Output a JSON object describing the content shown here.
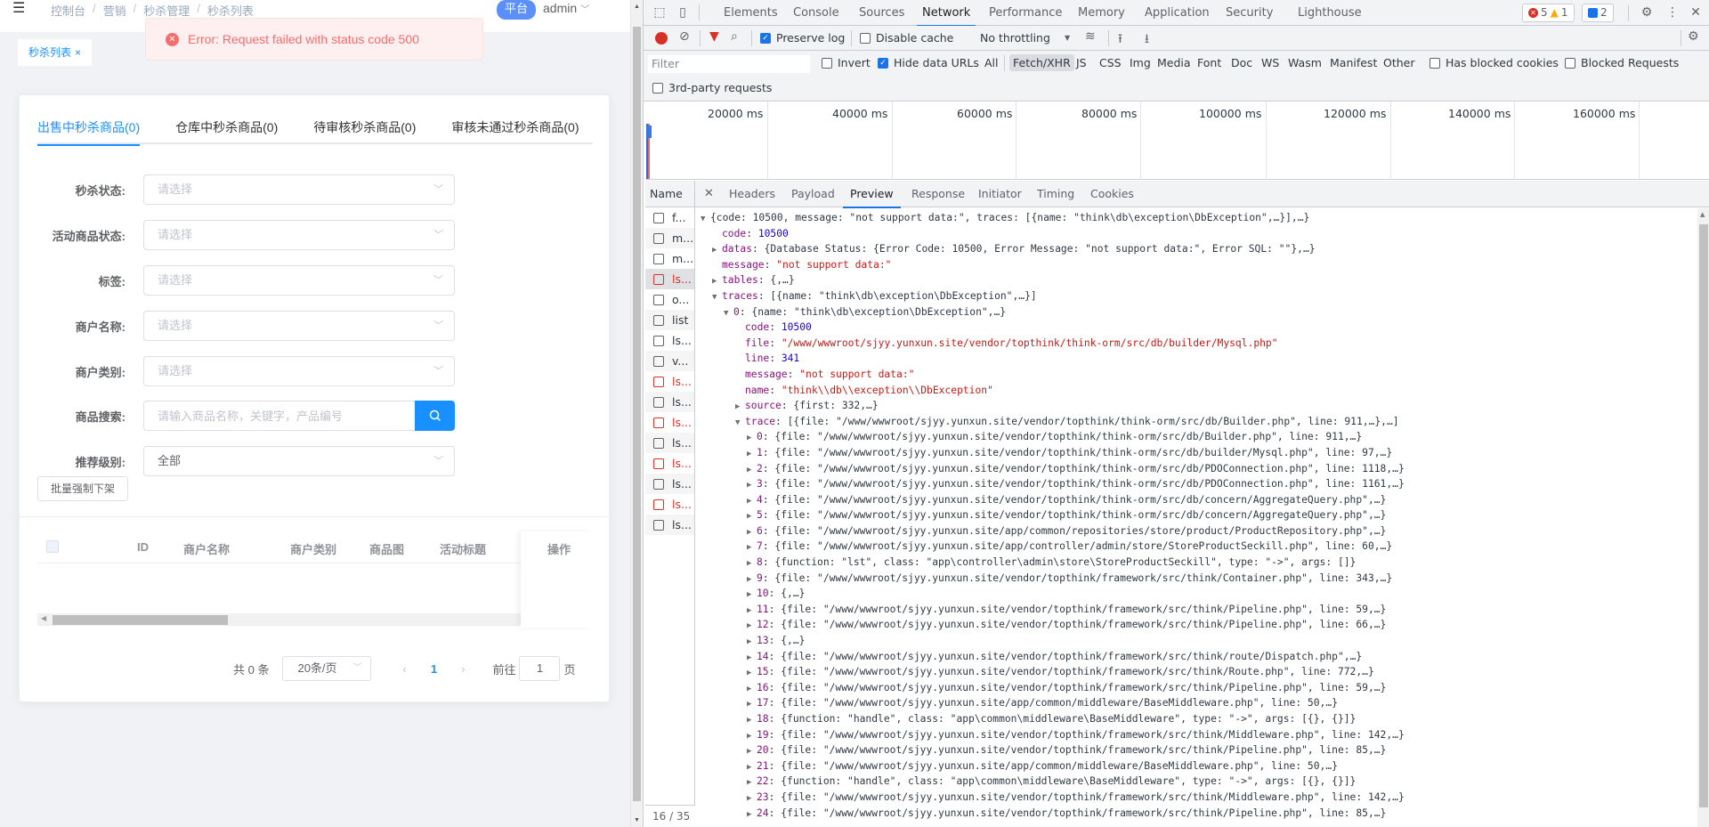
{
  "app": {
    "breadcrumb": [
      "控制台",
      "营销",
      "秒杀管理",
      "秒杀列表"
    ],
    "role_badge": "平台",
    "user": "admin",
    "tag": "秒杀列表",
    "error_message": "Error: Request failed with status code 500",
    "tabs": [
      {
        "label": "出售中秒杀商品(0)",
        "active": true
      },
      {
        "label": "仓库中秒杀商品(0)",
        "active": false
      },
      {
        "label": "待审核秒杀商品(0)",
        "active": false
      },
      {
        "label": "审核未通过秒杀商品(0)",
        "active": false
      }
    ],
    "filters": [
      {
        "label": "秒杀状态:",
        "placeholder": "请选择",
        "value": ""
      },
      {
        "label": "活动商品状态:",
        "placeholder": "请选择",
        "value": ""
      },
      {
        "label": "标签:",
        "placeholder": "请选择",
        "value": ""
      },
      {
        "label": "商户名称:",
        "placeholder": "请选择",
        "value": ""
      },
      {
        "label": "商户类别:",
        "placeholder": "请选择",
        "value": ""
      }
    ],
    "search": {
      "label": "商品搜索:",
      "placeholder": "请输入商品名称，关键字，产品编号"
    },
    "recommend": {
      "label": "推荐级别:",
      "value": "全部"
    },
    "batch_button": "批量强制下架",
    "table": {
      "columns": [
        "ID",
        "商户名称",
        "商户类别",
        "商品图",
        "活动标题"
      ],
      "fixed_column": "操作",
      "rows": []
    },
    "pagination": {
      "total": "共 0 条",
      "page_size": "20条/页",
      "current_page": "1",
      "goto_label": "前往",
      "goto_value": "1",
      "page_suffix": "页"
    }
  },
  "devtools": {
    "tabs": [
      "Elements",
      "Console",
      "Sources",
      "Network",
      "Performance",
      "Memory",
      "Application",
      "Security",
      "Lighthouse"
    ],
    "active_tab": "Network",
    "issues": {
      "errors": "5",
      "warnings": "1",
      "messages": "2"
    },
    "toolbar": {
      "preserve_log": "Preserve log",
      "preserve_log_checked": true,
      "disable_cache": "Disable cache",
      "disable_cache_checked": false,
      "throttling": "No throttling"
    },
    "filter": {
      "placeholder": "Filter",
      "invert": "Invert",
      "hide_data_urls": "Hide data URLs",
      "types": [
        "All",
        "Fetch/XHR",
        "JS",
        "CSS",
        "Img",
        "Media",
        "Font",
        "Doc",
        "WS",
        "Wasm",
        "Manifest",
        "Other"
      ],
      "selected_type": "Fetch/XHR",
      "has_blocked_cookies": "Has blocked cookies",
      "blocked_requests": "Blocked Requests",
      "third_party": "3rd-party requests"
    },
    "timeline_ticks": [
      "20000 ms",
      "40000 ms",
      "60000 ms",
      "80000 ms",
      "100000 ms",
      "120000 ms",
      "140000 ms",
      "160000 ms"
    ],
    "requests_header": "Name",
    "requests": [
      {
        "name": "f...",
        "error": false
      },
      {
        "name": "m...",
        "error": false
      },
      {
        "name": "m...",
        "error": false
      },
      {
        "name": "ls...",
        "error": true,
        "selected": true
      },
      {
        "name": "o...",
        "error": false
      },
      {
        "name": "list",
        "error": false
      },
      {
        "name": "ls...",
        "error": false
      },
      {
        "name": "v...",
        "error": false
      },
      {
        "name": "ls...",
        "error": true
      },
      {
        "name": "ls...",
        "error": false
      },
      {
        "name": "ls...",
        "error": true
      },
      {
        "name": "ls...",
        "error": false
      },
      {
        "name": "ls...",
        "error": true
      },
      {
        "name": "ls...",
        "error": false
      },
      {
        "name": "ls...",
        "error": true
      },
      {
        "name": "ls...",
        "error": false
      }
    ],
    "request_count": "16 / 35",
    "detail_tabs": [
      "Headers",
      "Payload",
      "Preview",
      "Response",
      "Initiator",
      "Timing",
      "Cookies"
    ],
    "active_detail_tab": "Preview",
    "preview_lines": [
      {
        "indent": 0,
        "tri": "down",
        "text": "{code: 10500, message: \"not support data:\", traces: [{name: \"think\\db\\exception\\DbException\",…}],…}",
        "kind": "summary"
      },
      {
        "indent": 1,
        "tri": "",
        "key": "code",
        "val": "10500",
        "vkind": "n"
      },
      {
        "indent": 1,
        "tri": "right",
        "key": "datas",
        "val": "{Database Status: {Error Code: 10500, Error Message: \"not support data:\", Error SQL: \"\"},…}",
        "vkind": "p"
      },
      {
        "indent": 1,
        "tri": "",
        "key": "message",
        "val": "\"not support data:\"",
        "vkind": "s"
      },
      {
        "indent": 1,
        "tri": "right",
        "key": "tables",
        "val": "{,…}",
        "vkind": "p"
      },
      {
        "indent": 1,
        "tri": "down",
        "key": "traces",
        "val": "[{name: \"think\\db\\exception\\DbException\",…}]",
        "vkind": "p"
      },
      {
        "indent": 2,
        "tri": "down",
        "key": "0",
        "val": "{name: \"think\\db\\exception\\DbException\",…}",
        "vkind": "p"
      },
      {
        "indent": 3,
        "tri": "",
        "key": "code",
        "val": "10500",
        "vkind": "n"
      },
      {
        "indent": 3,
        "tri": "",
        "key": "file",
        "val": "\"/www/wwwroot/sjyy.yunxun.site/vendor/topthink/think-orm/src/db/builder/Mysql.php\"",
        "vkind": "s"
      },
      {
        "indent": 3,
        "tri": "",
        "key": "line",
        "val": "341",
        "vkind": "n"
      },
      {
        "indent": 3,
        "tri": "",
        "key": "message",
        "val": "\"not support data:\"",
        "vkind": "s"
      },
      {
        "indent": 3,
        "tri": "",
        "key": "name",
        "val": "\"think\\\\db\\\\exception\\\\DbException\"",
        "vkind": "s"
      },
      {
        "indent": 3,
        "tri": "right",
        "key": "source",
        "val": "{first: 332,…}",
        "vkind": "p"
      },
      {
        "indent": 3,
        "tri": "down",
        "key": "trace",
        "val": "[{file: \"/www/wwwroot/sjyy.yunxun.site/vendor/topthink/think-orm/src/db/Builder.php\", line: 911,…},…]",
        "vkind": "p"
      },
      {
        "indent": 4,
        "tri": "right",
        "key": "0",
        "val": "{file: \"/www/wwwroot/sjyy.yunxun.site/vendor/topthink/think-orm/src/db/Builder.php\", line: 911,…}",
        "vkind": "p"
      },
      {
        "indent": 4,
        "tri": "right",
        "key": "1",
        "val": "{file: \"/www/wwwroot/sjyy.yunxun.site/vendor/topthink/think-orm/src/db/builder/Mysql.php\", line: 97,…}",
        "vkind": "p"
      },
      {
        "indent": 4,
        "tri": "right",
        "key": "2",
        "val": "{file: \"/www/wwwroot/sjyy.yunxun.site/vendor/topthink/think-orm/src/db/PDOConnection.php\", line: 1118,…}",
        "vkind": "p"
      },
      {
        "indent": 4,
        "tri": "right",
        "key": "3",
        "val": "{file: \"/www/wwwroot/sjyy.yunxun.site/vendor/topthink/think-orm/src/db/PDOConnection.php\", line: 1161,…}",
        "vkind": "p"
      },
      {
        "indent": 4,
        "tri": "right",
        "key": "4",
        "val": "{file: \"/www/wwwroot/sjyy.yunxun.site/vendor/topthink/think-orm/src/db/concern/AggregateQuery.php\",…}",
        "vkind": "p"
      },
      {
        "indent": 4,
        "tri": "right",
        "key": "5",
        "val": "{file: \"/www/wwwroot/sjyy.yunxun.site/vendor/topthink/think-orm/src/db/concern/AggregateQuery.php\",…}",
        "vkind": "p"
      },
      {
        "indent": 4,
        "tri": "right",
        "key": "6",
        "val": "{file: \"/www/wwwroot/sjyy.yunxun.site/app/common/repositories/store/product/ProductRepository.php\",…}",
        "vkind": "p"
      },
      {
        "indent": 4,
        "tri": "right",
        "key": "7",
        "val": "{file: \"/www/wwwroot/sjyy.yunxun.site/app/controller/admin/store/StoreProductSeckill.php\", line: 60,…}",
        "vkind": "p"
      },
      {
        "indent": 4,
        "tri": "right",
        "key": "8",
        "val": "{function: \"lst\", class: \"app\\controller\\admin\\store\\StoreProductSeckill\", type: \"->\", args: []}",
        "vkind": "p"
      },
      {
        "indent": 4,
        "tri": "right",
        "key": "9",
        "val": "{file: \"/www/wwwroot/sjyy.yunxun.site/vendor/topthink/framework/src/think/Container.php\", line: 343,…}",
        "vkind": "p"
      },
      {
        "indent": 4,
        "tri": "right",
        "key": "10",
        "val": "{,…}",
        "vkind": "p"
      },
      {
        "indent": 4,
        "tri": "right",
        "key": "11",
        "val": "{file: \"/www/wwwroot/sjyy.yunxun.site/vendor/topthink/framework/src/think/Pipeline.php\", line: 59,…}",
        "vkind": "p"
      },
      {
        "indent": 4,
        "tri": "right",
        "key": "12",
        "val": "{file: \"/www/wwwroot/sjyy.yunxun.site/vendor/topthink/framework/src/think/Pipeline.php\", line: 66,…}",
        "vkind": "p"
      },
      {
        "indent": 4,
        "tri": "right",
        "key": "13",
        "val": "{,…}",
        "vkind": "p"
      },
      {
        "indent": 4,
        "tri": "right",
        "key": "14",
        "val": "{file: \"/www/wwwroot/sjyy.yunxun.site/vendor/topthink/framework/src/think/route/Dispatch.php\",…}",
        "vkind": "p"
      },
      {
        "indent": 4,
        "tri": "right",
        "key": "15",
        "val": "{file: \"/www/wwwroot/sjyy.yunxun.site/vendor/topthink/framework/src/think/Route.php\", line: 772,…}",
        "vkind": "p"
      },
      {
        "indent": 4,
        "tri": "right",
        "key": "16",
        "val": "{file: \"/www/wwwroot/sjyy.yunxun.site/vendor/topthink/framework/src/think/Pipeline.php\", line: 59,…}",
        "vkind": "p"
      },
      {
        "indent": 4,
        "tri": "right",
        "key": "17",
        "val": "{file: \"/www/wwwroot/sjyy.yunxun.site/app/common/middleware/BaseMiddleware.php\", line: 50,…}",
        "vkind": "p"
      },
      {
        "indent": 4,
        "tri": "right",
        "key": "18",
        "val": "{function: \"handle\", class: \"app\\common\\middleware\\BaseMiddleware\", type: \"->\", args: [{}, {}]}",
        "vkind": "p"
      },
      {
        "indent": 4,
        "tri": "right",
        "key": "19",
        "val": "{file: \"/www/wwwroot/sjyy.yunxun.site/vendor/topthink/framework/src/think/Middleware.php\", line: 142,…}",
        "vkind": "p"
      },
      {
        "indent": 4,
        "tri": "right",
        "key": "20",
        "val": "{file: \"/www/wwwroot/sjyy.yunxun.site/vendor/topthink/framework/src/think/Pipeline.php\", line: 85,…}",
        "vkind": "p"
      },
      {
        "indent": 4,
        "tri": "right",
        "key": "21",
        "val": "{file: \"/www/wwwroot/sjyy.yunxun.site/app/common/middleware/BaseMiddleware.php\", line: 50,…}",
        "vkind": "p"
      },
      {
        "indent": 4,
        "tri": "right",
        "key": "22",
        "val": "{function: \"handle\", class: \"app\\common\\middleware\\BaseMiddleware\", type: \"->\", args: [{}, {}]}",
        "vkind": "p"
      },
      {
        "indent": 4,
        "tri": "right",
        "key": "23",
        "val": "{file: \"/www/wwwroot/sjyy.yunxun.site/vendor/topthink/framework/src/think/Middleware.php\", line: 142,…}",
        "vkind": "p"
      },
      {
        "indent": 4,
        "tri": "right",
        "key": "24",
        "val": "{file: \"/www/wwwroot/sjyy.yunxun.site/vendor/topthink/framework/src/think/Pipeline.php\", line: 85,…}",
        "vkind": "p"
      }
    ]
  }
}
